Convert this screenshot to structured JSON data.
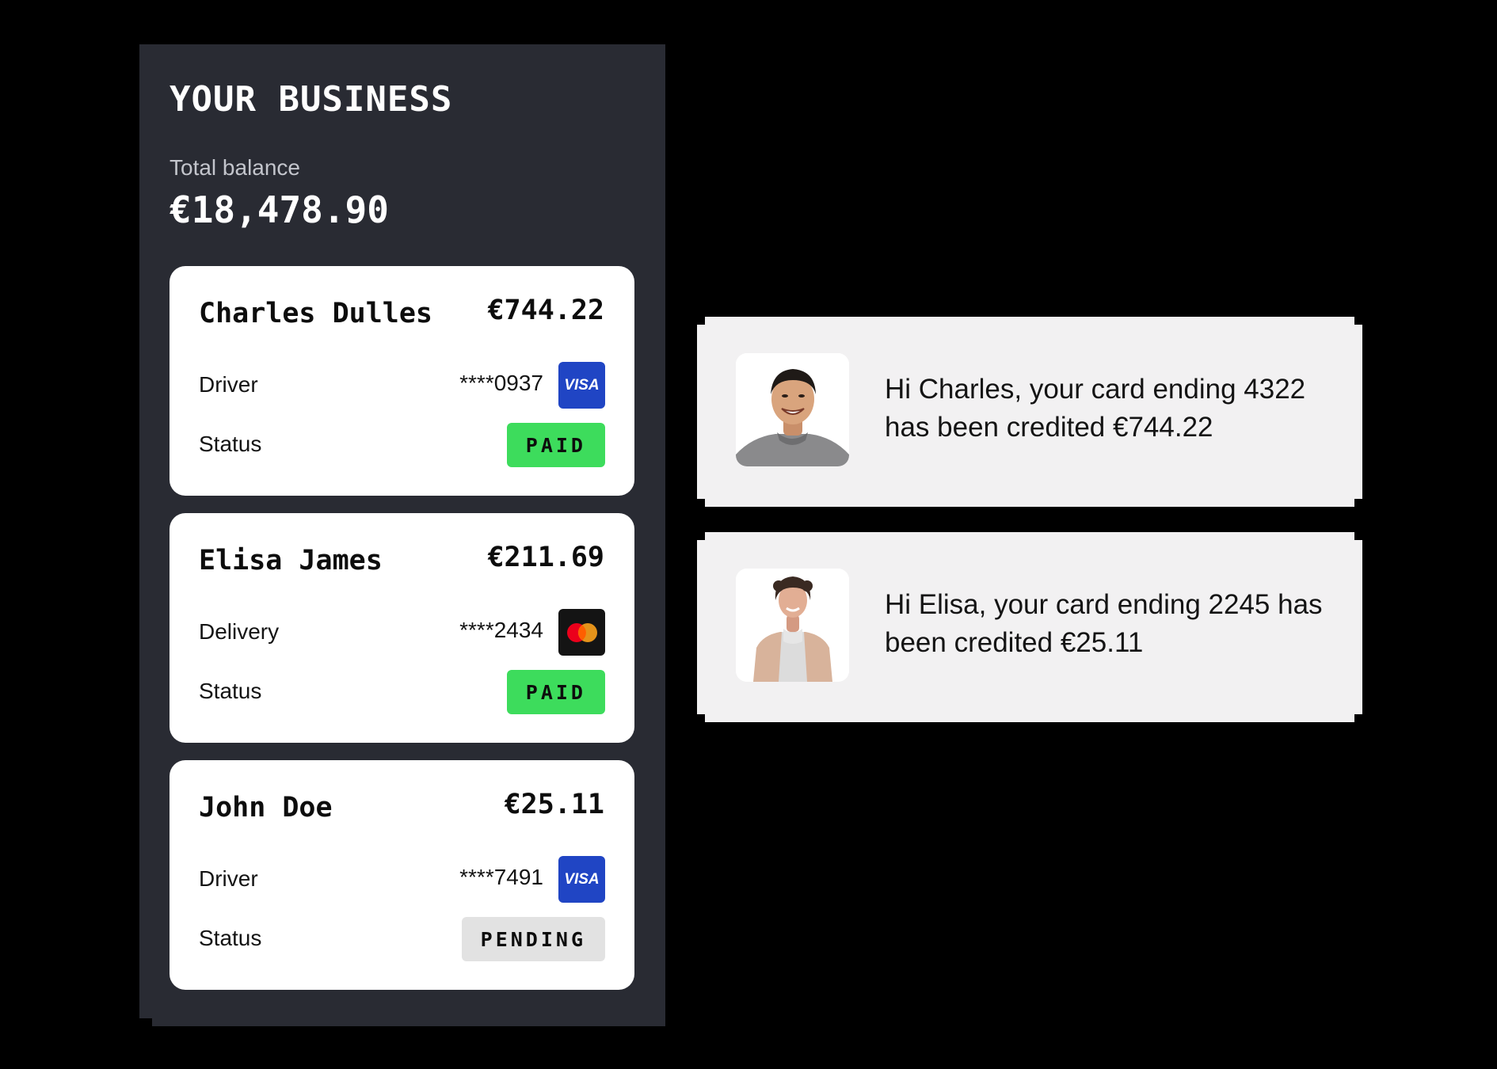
{
  "business": {
    "title": "YOUR BUSINESS",
    "balance_label": "Total balance",
    "balance_value": "€18,478.90"
  },
  "transactions": [
    {
      "name": "Charles Dulles",
      "amount": "€744.22",
      "role": "Driver",
      "card_number": "****0937",
      "card_brand": "VISA",
      "card_brand_icon": "visa-logo",
      "status_label": "Status",
      "status": "PAID"
    },
    {
      "name": "Elisa James",
      "amount": "€211.69",
      "role": "Delivery",
      "card_number": "****2434",
      "card_brand_icon": "mastercard-logo",
      "status_label": "Status",
      "status": "PAID"
    },
    {
      "name": "John Doe",
      "amount": "€25.11",
      "role": "Driver",
      "card_number": "****7491",
      "card_brand": "VISA",
      "card_brand_icon": "visa-logo",
      "status_label": "Status",
      "status": "PENDING"
    }
  ],
  "notifications": [
    {
      "avatar_icon": "person-avatar",
      "message": "Hi Charles, your card ending 4322 has been credited €744.22"
    },
    {
      "avatar_icon": "person-avatar",
      "message": "Hi Elisa, your card ending 2245 has been credited €25.11"
    }
  ],
  "colors": {
    "page_background": "#000000",
    "panel_background": "#292b33",
    "paid_badge": "#3ddc5c",
    "pending_badge": "#e2e2e2",
    "visa_blue": "#2045c4",
    "mastercard_red": "#eb001b",
    "mastercard_orange": "#f79e1b",
    "notification_background": "#f2f1f2"
  }
}
